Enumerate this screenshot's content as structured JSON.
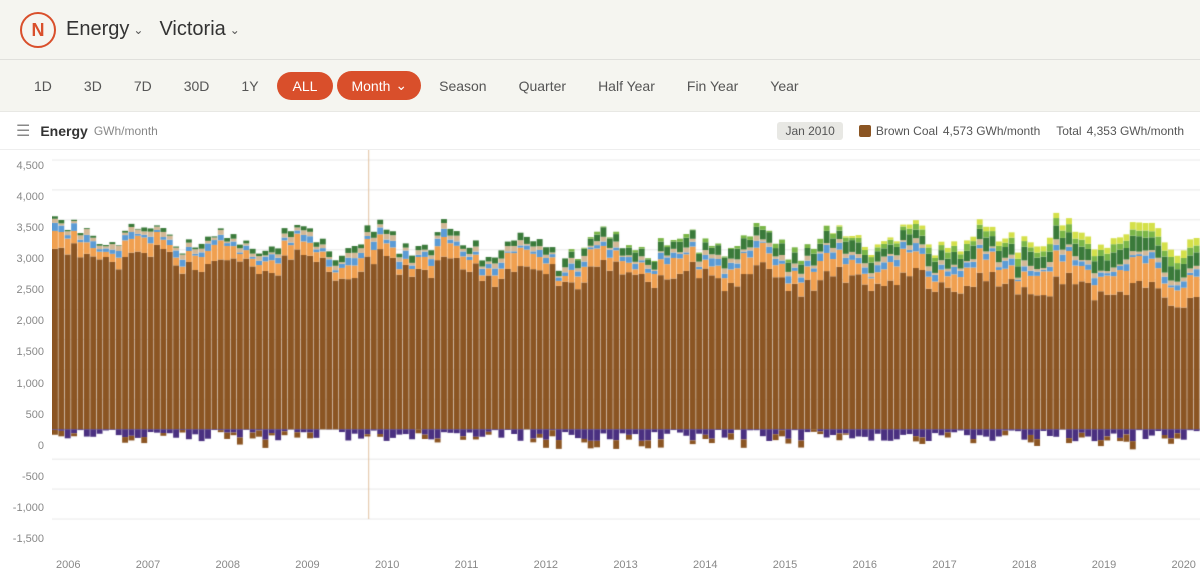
{
  "header": {
    "logo_symbol": "N",
    "app_title": "Energy",
    "region": "Victoria"
  },
  "toolbar": {
    "time_buttons": [
      "1D",
      "3D",
      "7D",
      "30D",
      "1Y",
      "ALL"
    ],
    "active_time": "ALL",
    "period_buttons": [
      "Month",
      "Season",
      "Quarter",
      "Half Year",
      "Fin Year",
      "Year"
    ],
    "active_period": "Month",
    "active_period_has_arrow": true
  },
  "chart": {
    "title": "Energy",
    "unit": "GWh/month",
    "legend_date": "Jan 2010",
    "legend_items": [
      {
        "label": "Brown Coal",
        "value": "4,573 GWh/month",
        "color": "#8B4513"
      },
      {
        "label": "Total",
        "value": "4,353 GWh/month",
        "color": null
      }
    ],
    "y_axis": [
      "4,500",
      "4,000",
      "3,500",
      "3,000",
      "2,500",
      "2,000",
      "1,500",
      "1,000",
      "500",
      "0",
      "-500",
      "-1,000",
      "-1,500"
    ],
    "x_axis": [
      "2006",
      "2007",
      "2008",
      "2009",
      "2010",
      "2011",
      "2012",
      "2013",
      "2014",
      "2015",
      "2016",
      "2017",
      "2018",
      "2019",
      "2020"
    ],
    "colors": {
      "brown_coal": "#8B5523",
      "blue": "#5b9bd5",
      "orange": "#f0a050",
      "green_dark": "#3a7a3a",
      "green_light": "#7ab648",
      "yellow": "#d4e04a",
      "tan": "#d4b896",
      "purple": "#4a3080",
      "grid": "#e8e8e4",
      "zero_line": "#ccc"
    }
  }
}
